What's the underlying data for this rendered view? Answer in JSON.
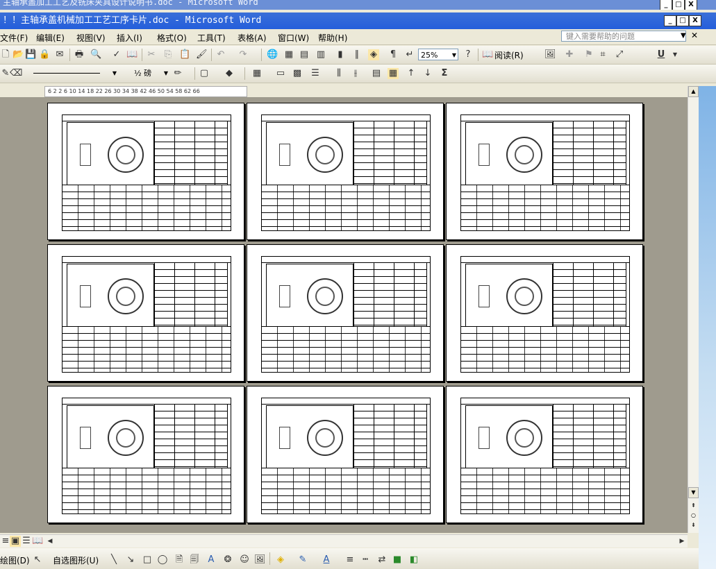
{
  "window": {
    "outer_title": "主轴承盖加工工艺及铣床夹具设计说明书.doc - Microsoft Word",
    "doc_title": "！！主轴承盖机械加工工艺工序卡片.doc - Microsoft Word",
    "min": "_",
    "max": "□",
    "close": "X"
  },
  "menu": {
    "items": [
      "文件(F)",
      "编辑(E)",
      "视图(V)",
      "插入(I)",
      "格式(O)",
      "工具(T)",
      "表格(A)",
      "窗口(W)",
      "帮助(H)"
    ],
    "help_placeholder": "键入需要帮助的问题"
  },
  "toolbar": {
    "zoom": "25%",
    "read_label": "阅读(R)"
  },
  "format_toolbar": {
    "line_weight": "½ 磅"
  },
  "ruler": {
    "ticks": "6  2  2  6  10 14 18 22 26 30 34 38 42 46 50 54 58 62 66"
  },
  "drawing_toolbar": {
    "draw_menu": "绘图(D)",
    "autoshapes": "自选图形(U)"
  },
  "document": {
    "page_count": 9
  }
}
